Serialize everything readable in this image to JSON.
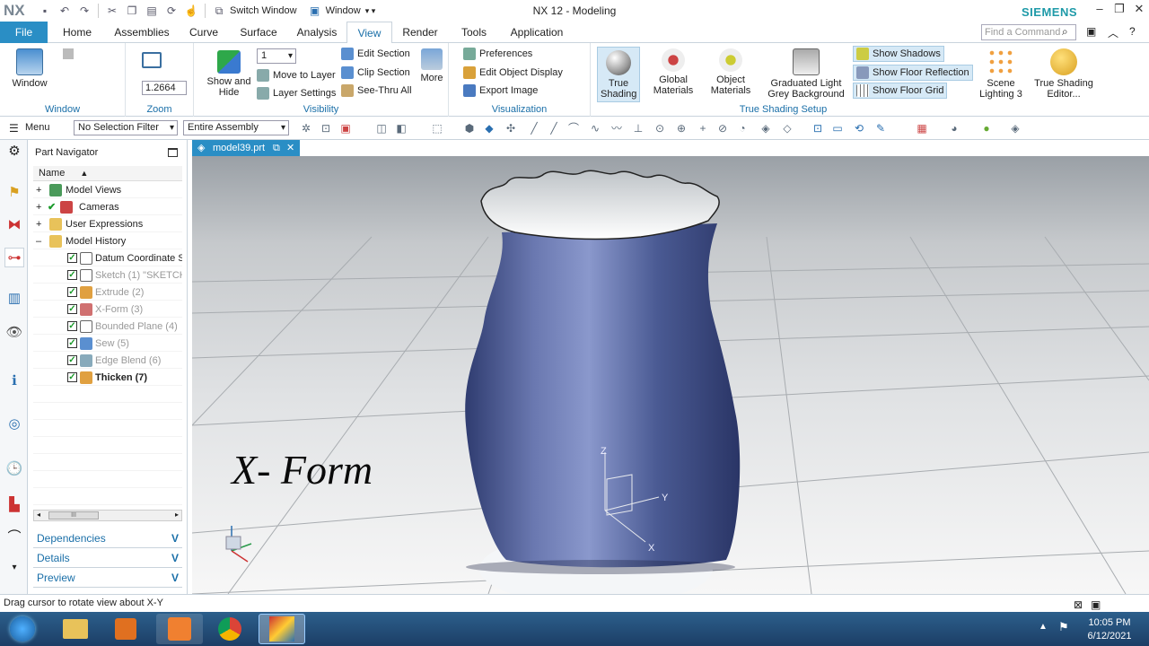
{
  "app": {
    "logo": "NX",
    "title": "NX 12 - Modeling",
    "brand": "SIEMENS"
  },
  "quickaccess": {
    "switch_window": "Switch Window",
    "window": "Window"
  },
  "tabs": [
    {
      "label": "File"
    },
    {
      "label": "Home"
    },
    {
      "label": "Assemblies"
    },
    {
      "label": "Curve"
    },
    {
      "label": "Surface"
    },
    {
      "label": "Analysis"
    },
    {
      "label": "View"
    },
    {
      "label": "Render"
    },
    {
      "label": "Tools"
    },
    {
      "label": "Application"
    }
  ],
  "search": {
    "placeholder": "Find a Command"
  },
  "ribbon": {
    "window": {
      "label": "Window",
      "group": "Window"
    },
    "zoom": {
      "value": "1.2664",
      "group": "Zoom"
    },
    "visibility": {
      "layer_value": "1",
      "show_hide": "Show and Hide",
      "move_layer": "Move to Layer",
      "layer_settings": "Layer Settings",
      "edit_section": "Edit Section",
      "clip_section": "Clip Section",
      "see_thru": "See-Thru All",
      "more": "More",
      "group": "Visibility"
    },
    "visualization": {
      "preferences": "Preferences",
      "edit_object_display": "Edit Object Display",
      "export_image": "Export Image",
      "group": "Visualization"
    },
    "true_shading": "True Shading",
    "tss": {
      "global_materials": "Global Materials",
      "object_materials": "Object Materials",
      "graduated": "Graduated Light Grey Background",
      "show_shadows": "Show Shadows",
      "show_floor_reflection": "Show Floor Reflection",
      "show_floor_grid": "Show Floor Grid",
      "scene_lighting": "Scene Lighting 3",
      "tse": "True Shading Editor...",
      "group": "True Shading Setup"
    }
  },
  "selection": {
    "menu": "Menu",
    "filter": "No Selection Filter",
    "scope": "Entire Assembly"
  },
  "navigator": {
    "title": "Part Navigator",
    "column": "Name",
    "items": [
      {
        "label": "Model Views"
      },
      {
        "label": "Cameras"
      },
      {
        "label": "User Expressions"
      },
      {
        "label": "Model History"
      },
      {
        "label": "Datum Coordinate S"
      },
      {
        "label": "Sketch (1) \"SKETCH"
      },
      {
        "label": "Extrude (2)"
      },
      {
        "label": "X-Form (3)"
      },
      {
        "label": "Bounded Plane (4)"
      },
      {
        "label": "Sew (5)"
      },
      {
        "label": "Edge Blend (6)"
      },
      {
        "label": "Thicken (7)"
      }
    ],
    "scroll_thumb": "III",
    "panels": [
      {
        "label": "Dependencies"
      },
      {
        "label": "Details"
      },
      {
        "label": "Preview"
      }
    ]
  },
  "document": {
    "tab": "model39.prt"
  },
  "viewport": {
    "overlay_text": "X- Form",
    "axis": {
      "z": "Z",
      "y": "Y",
      "x": "X"
    }
  },
  "status": {
    "text": "Drag cursor to rotate view about X-Y"
  },
  "clock": {
    "time": "10:05 PM",
    "date": "6/12/2021"
  },
  "colors": {
    "accent": "#2a8ec5",
    "vase": "#4a5a93",
    "brand": "#1e9aa8"
  }
}
